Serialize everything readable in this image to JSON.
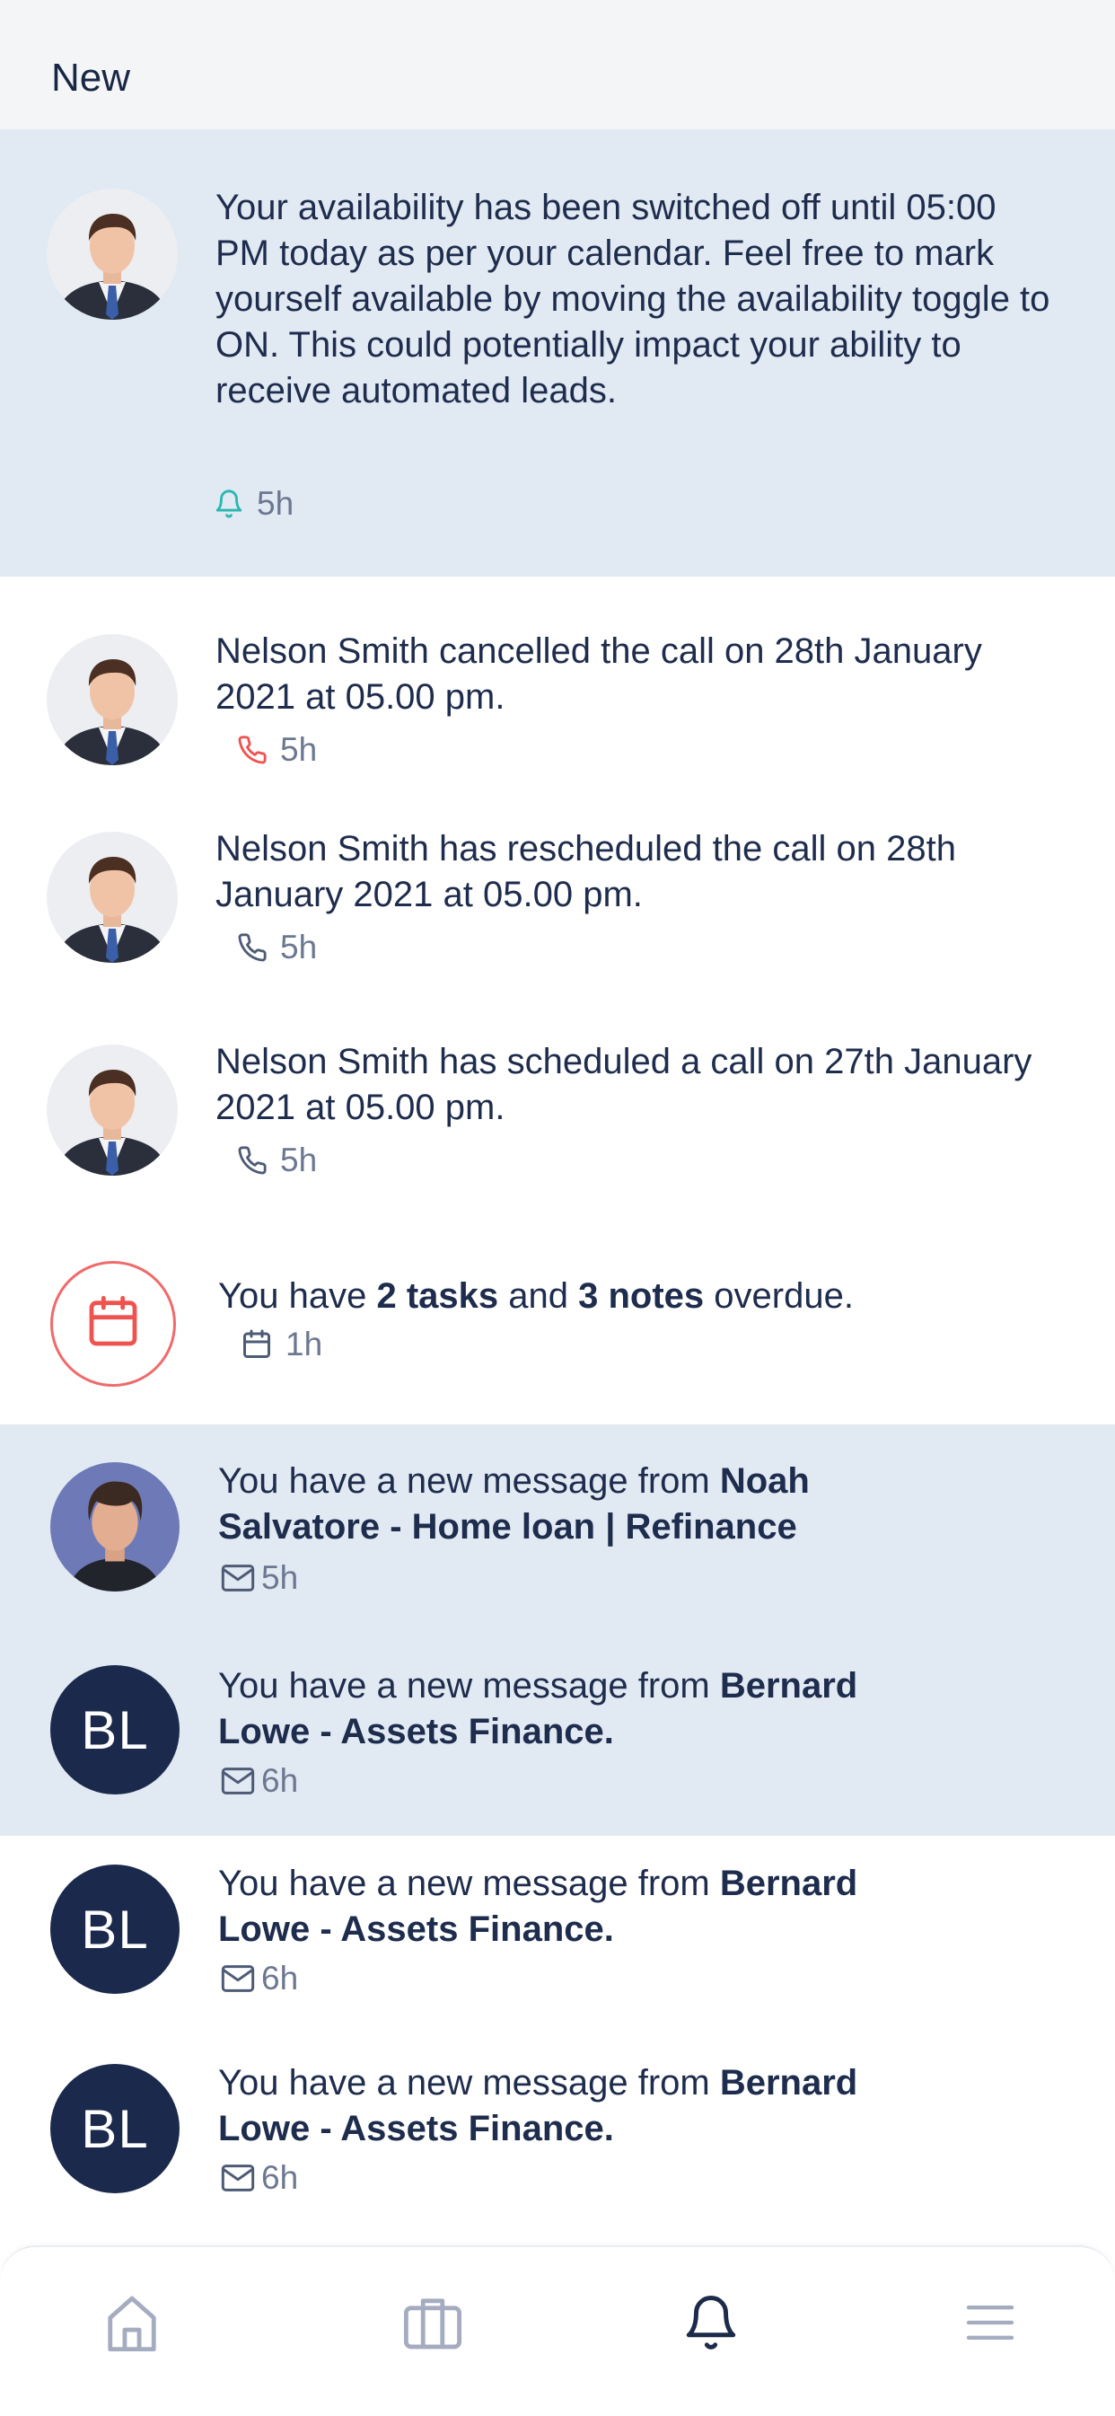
{
  "header": {
    "title": "New"
  },
  "notifications": {
    "availability": {
      "text": "Your availability has been switched off until 05:00 PM today as per your calendar. Feel free to mark yourself available by moving the availability toggle to ON. This could potentially impact your ability to receive automated leads.",
      "time": "5h",
      "icon": "bell-icon"
    },
    "call_cancelled": {
      "text": "Nelson Smith cancelled the call on 28th January 2021 at 05.00 pm.",
      "time": "5h",
      "icon": "phone-icon",
      "icon_color": "#ef5350"
    },
    "call_rescheduled": {
      "text": "Nelson Smith has rescheduled the call on 28th January 2021 at 05.00 pm.",
      "time": "5h",
      "icon": "phone-icon"
    },
    "call_scheduled": {
      "text": "Nelson Smith has scheduled a call on 27th January 2021 at 05.00 pm.",
      "time": "5h",
      "icon": "phone-icon"
    },
    "overdue": {
      "prefix": "You have ",
      "tasks": "2 tasks",
      "middle": " and ",
      "notes": "3 notes",
      "suffix": " overdue.",
      "time": "1h",
      "icon": "calendar-icon"
    },
    "message_noah": {
      "prefix": "You have a new message from ",
      "sender": "Noah Salvatore - Home loan | Refinance",
      "time": "5h",
      "icon": "mail-icon"
    },
    "message_bernard_1": {
      "initials": "BL",
      "prefix": "You have a new message from ",
      "sender": "Bernard Lowe - Assets Finance.",
      "time": "6h",
      "icon": "mail-icon"
    },
    "message_bernard_2": {
      "initials": "BL",
      "prefix": "You have a new message from ",
      "sender": "Bernard Lowe - Assets Finance.",
      "time": "6h",
      "icon": "mail-icon"
    },
    "message_bernard_3": {
      "initials": "BL",
      "prefix": "You have a new message from ",
      "sender": "Bernard Lowe - Assets Finance.",
      "time": "6h",
      "icon": "mail-icon"
    }
  },
  "tabbar": {
    "items": [
      "home-icon",
      "briefcase-icon",
      "bell-icon",
      "menu-icon"
    ],
    "active": "bell-icon"
  },
  "colors": {
    "highlight_bg": "#e1e9f2",
    "navy": "#1b2a4c",
    "accent_teal": "#2ab7b0",
    "alert_red": "#ef5350"
  }
}
